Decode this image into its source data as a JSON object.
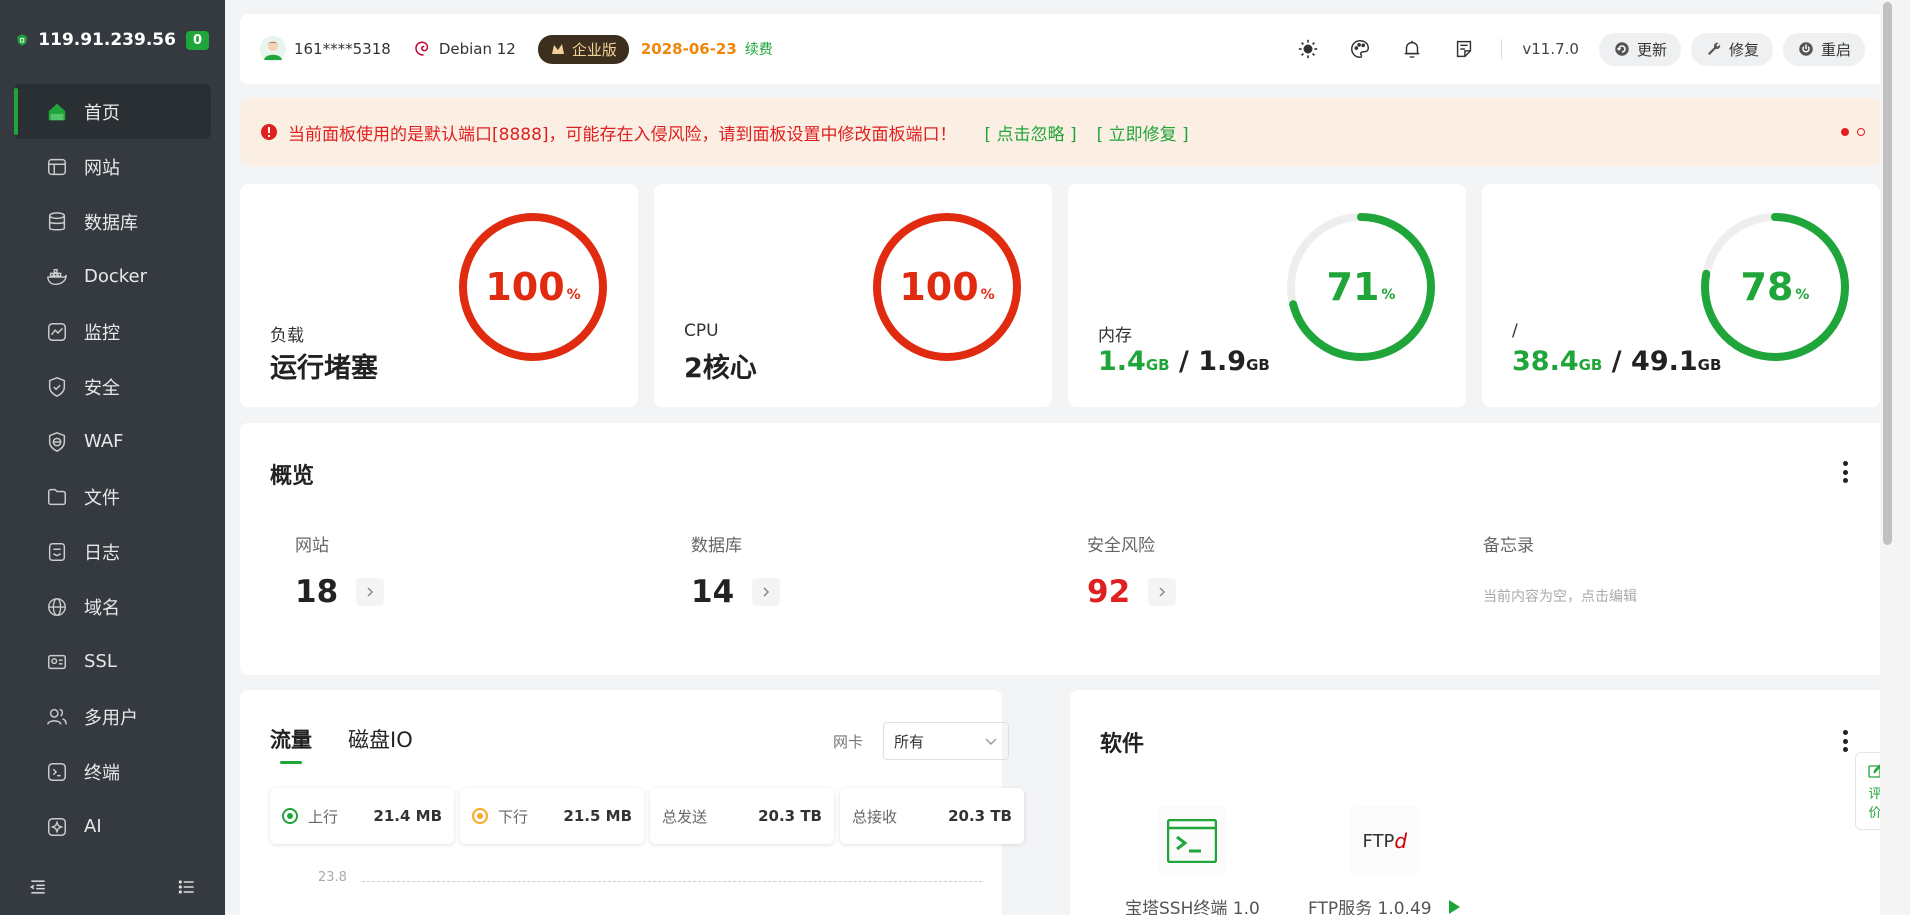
{
  "sidebar": {
    "ip": "119.91.239.56",
    "badge": "0",
    "items": [
      {
        "label": "首页",
        "icon": "home-icon"
      },
      {
        "label": "网站",
        "icon": "website-icon"
      },
      {
        "label": "数据库",
        "icon": "database-icon"
      },
      {
        "label": "Docker",
        "icon": "docker-icon"
      },
      {
        "label": "监控",
        "icon": "monitor-icon"
      },
      {
        "label": "安全",
        "icon": "shield-check-icon"
      },
      {
        "label": "WAF",
        "icon": "waf-icon"
      },
      {
        "label": "文件",
        "icon": "folder-icon"
      },
      {
        "label": "日志",
        "icon": "log-icon"
      },
      {
        "label": "域名",
        "icon": "globe-icon"
      },
      {
        "label": "SSL",
        "icon": "ssl-icon"
      },
      {
        "label": "多用户",
        "icon": "users-icon"
      },
      {
        "label": "终端",
        "icon": "terminal-icon"
      },
      {
        "label": "AI",
        "icon": "ai-icon"
      }
    ]
  },
  "topbar": {
    "user": "161****5318",
    "os": "Debian 12",
    "edition": "企业版",
    "expire": "2028-06-23",
    "renew": "续费",
    "version": "v11.7.0",
    "update": "更新",
    "repair": "修复",
    "restart": "重启"
  },
  "alert": {
    "message": "当前面板使用的是默认端口[8888]，可能存在入侵风险，请到面板设置中修改面板端口！",
    "ignore": "[ 点击忽略 ]",
    "fix": "[ 立即修复 ]"
  },
  "stats": {
    "load": {
      "label": "负载",
      "value": "运行堵塞",
      "percent": "100",
      "pct_sign": "%",
      "fraction": 1.0,
      "color": "#e02b10"
    },
    "cpu": {
      "label": "CPU",
      "value": "2核心",
      "percent": "100",
      "pct_sign": "%",
      "fraction": 1.0,
      "color": "#e02b10"
    },
    "mem": {
      "label": "内存",
      "used": "1.4",
      "used_unit": "GB",
      "sep": " / ",
      "total": "1.9",
      "total_unit": "GB",
      "percent": "71",
      "pct_sign": "%",
      "fraction": 0.71,
      "color": "#20a53a"
    },
    "disk": {
      "label": "/",
      "used": "38.4",
      "used_unit": "GB",
      "sep": " / ",
      "total": "49.1",
      "total_unit": "GB",
      "percent": "78",
      "pct_sign": "%",
      "fraction": 0.78,
      "color": "#20a53a"
    }
  },
  "overview": {
    "title": "概览",
    "website": {
      "label": "网站",
      "count": "18"
    },
    "database": {
      "label": "数据库",
      "count": "14"
    },
    "risk": {
      "label": "安全风险",
      "count": "92"
    },
    "memo": {
      "label": "备忘录",
      "text": "当前内容为空，点击编辑"
    }
  },
  "traffic": {
    "tab_flow": "流量",
    "tab_disk": "磁盘IO",
    "nic_label": "网卡",
    "nic_value": "所有",
    "up_label": "上行",
    "up_value": "21.4 MB",
    "down_label": "下行",
    "down_value": "21.5 MB",
    "sent_label": "总发送",
    "sent_value": "20.3 TB",
    "recv_label": "总接收",
    "recv_value": "20.3 TB",
    "axis_top": "23.8"
  },
  "software": {
    "title": "软件",
    "items": [
      {
        "name": "宝塔SSH终端 1.0"
      },
      {
        "name": "FTP服务 1.0.49",
        "icon_text": "FTP"
      }
    ]
  },
  "feedback": {
    "line1": "评",
    "line2": "价"
  }
}
